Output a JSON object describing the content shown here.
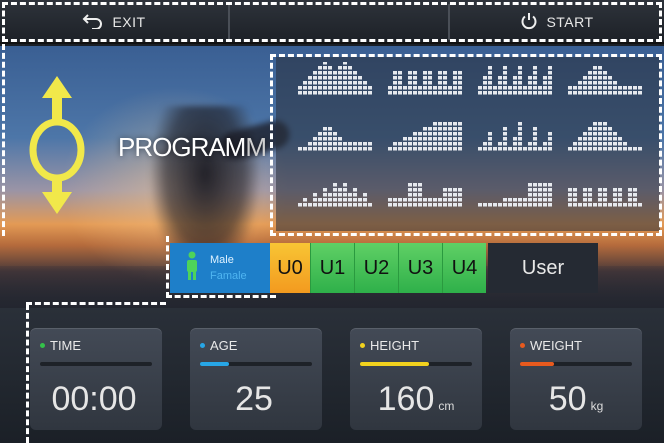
{
  "topbar": {
    "exit_label": "EXIT",
    "start_label": "START"
  },
  "program": {
    "label_main": "PROGRAM",
    "label_suffix": "M",
    "icons": [
      "program-1",
      "program-2",
      "program-3",
      "program-4",
      "program-5",
      "program-6",
      "program-7",
      "program-8",
      "program-9",
      "program-10",
      "program-11",
      "program-12"
    ]
  },
  "gender": {
    "male_label": "Male",
    "female_label": "Famale"
  },
  "user_slots": [
    "U0",
    "U1",
    "U2",
    "U3",
    "U4"
  ],
  "user_label": "User",
  "stats": [
    {
      "label": "TIME",
      "value": "00:00",
      "unit": "",
      "accent": "#34c24a",
      "fill": 0.0
    },
    {
      "label": "AGE",
      "value": "25",
      "unit": "",
      "accent": "#27a6e6",
      "fill": 0.26
    },
    {
      "label": "HEIGHT",
      "value": "160",
      "unit": "cm",
      "accent": "#f2d21e",
      "fill": 0.62
    },
    {
      "label": "WEIGHT",
      "value": "50",
      "unit": "kg",
      "accent": "#e85a1e",
      "fill": 0.3
    }
  ],
  "colors": {
    "male_bg": "#1e7fc9",
    "u0": "#f39a1f",
    "u_green": "#2fb04a",
    "arrows": "#f1e84a"
  }
}
